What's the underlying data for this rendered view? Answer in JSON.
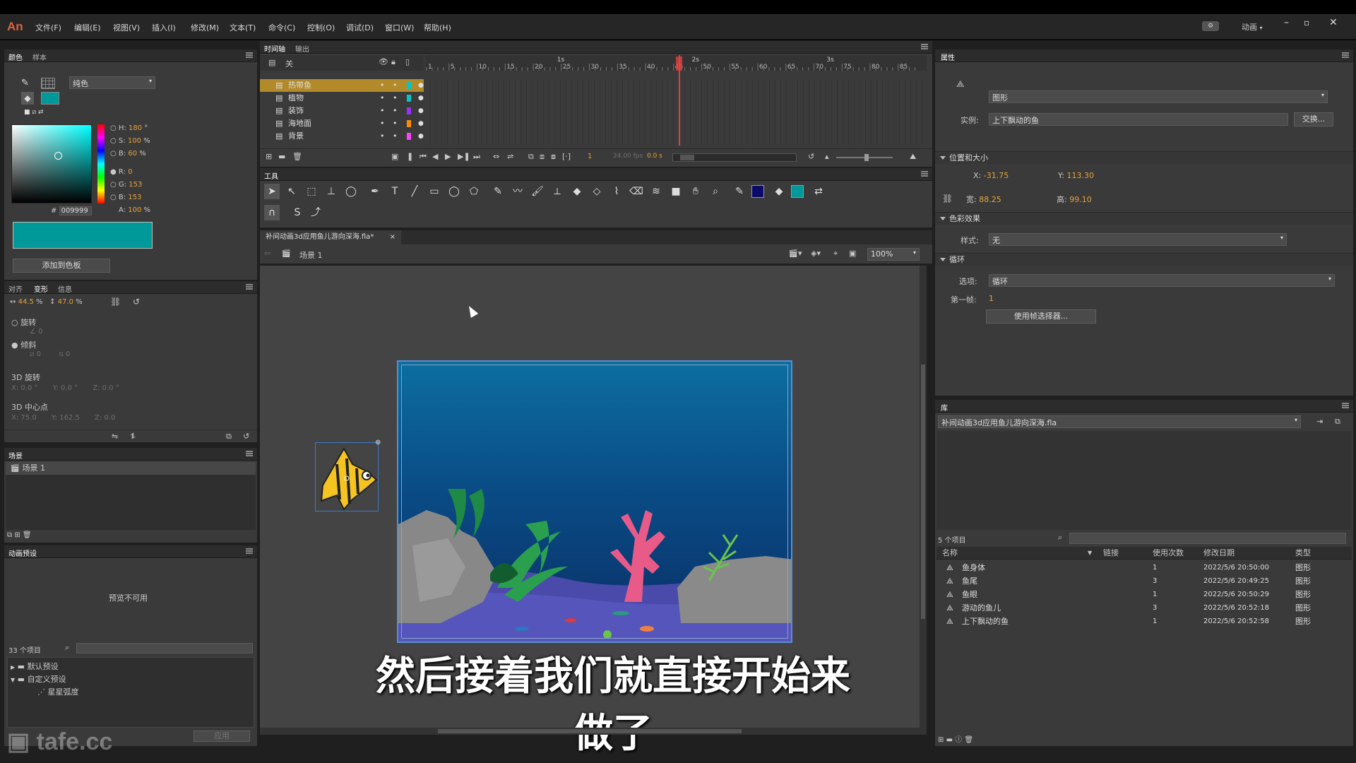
{
  "app": {
    "logo": "An",
    "menu": [
      "文件(F)",
      "编辑(E)",
      "视图(V)",
      "插入(I)",
      "修改(M)",
      "文本(T)",
      "命令(C)",
      "控制(O)",
      "调试(D)",
      "窗口(W)",
      "帮助(H)"
    ],
    "workspace": "动画"
  },
  "color_panel": {
    "tabs": [
      "颜色",
      "样本"
    ],
    "fill_type": "纯色",
    "hsb": {
      "h_label": "H:",
      "h": "180",
      "h_unit": "°",
      "s_label": "S:",
      "s": "100",
      "s_unit": "%",
      "b_label": "B:",
      "b": "60",
      "b_unit": "%"
    },
    "rgb": {
      "r_label": "R:",
      "r": "0",
      "g_label": "G:",
      "g": "153",
      "b_label": "B:",
      "b": "153"
    },
    "alpha_label": "A:",
    "alpha": "100",
    "alpha_unit": "%",
    "hex_label": "#",
    "hex": "009999",
    "add_swatch": "添加到色板",
    "swatch_color": "#009999"
  },
  "transform_panel": {
    "tabs": [
      "对齐",
      "变形",
      "信息"
    ],
    "width_pct": "44.5",
    "height_pct": "47.0",
    "pct": "%",
    "rotate_label": "旋转",
    "rotate_value": "0",
    "skew_label": "倾斜",
    "skew_h": "0",
    "skew_v": "0",
    "rot3d_label": "3D 旋转",
    "rot3d": {
      "x_label": "X:",
      "x": "0.0 °",
      "y_label": "Y:",
      "y": "0.0 °",
      "z_label": "Z:",
      "z": "0.0 °"
    },
    "center3d_label": "3D 中心点",
    "center3d": {
      "x_label": "X:",
      "x": "75.0",
      "y_label": "Y:",
      "y": "162.5",
      "z_label": "Z:",
      "z": "0.0"
    }
  },
  "scene_panel": {
    "title": "场景",
    "scenes": [
      "场景 1"
    ]
  },
  "presets_panel": {
    "title": "动画预设",
    "preview": "预览不可用",
    "count": "33 个项目",
    "tree": [
      {
        "label": "默认预设",
        "expanded": false
      },
      {
        "label": "自定义预设",
        "expanded": true
      },
      {
        "label": "星星弧度",
        "child": true
      }
    ],
    "apply": "应用"
  },
  "timeline": {
    "tabs": [
      "时间轴",
      "输出"
    ],
    "header_label": "关",
    "seconds": [
      "1s",
      "2s",
      "3s"
    ],
    "frame_ticks": [
      "1",
      "5",
      "10",
      "15",
      "20",
      "25",
      "30",
      "35",
      "40",
      "45",
      "50",
      "55",
      "60",
      "65",
      "70",
      "75",
      "80",
      "85"
    ],
    "layers": [
      {
        "name": "热带鱼",
        "color": "#00c8c8",
        "selected": true
      },
      {
        "name": "植物",
        "color": "#00c8c8",
        "selected": false
      },
      {
        "name": "装饰",
        "color": "#9b30ff",
        "selected": false
      },
      {
        "name": "海地面",
        "color": "#ff8c00",
        "selected": false
      },
      {
        "name": "背景",
        "color": "#ff40ff",
        "selected": false
      }
    ],
    "current_frame": "1",
    "fps": "24.00 fps",
    "time": "0.0 s"
  },
  "tools": {
    "title": "工具"
  },
  "document": {
    "tab": "补间动画3d应用鱼儿游向深海.fla*",
    "scene": "场景 1",
    "zoom": "100%"
  },
  "subtitle": "然后接着我们就直接开始来做了",
  "watermark": "tafe.cc",
  "properties": {
    "title": "属性",
    "symbol_type": "图形",
    "instance_label": "实例:",
    "instance_name": "上下飘动的鱼",
    "swap_btn": "交换...",
    "pos_section": "位置和大小",
    "x_label": "X:",
    "x": "-31.75",
    "y_label": "Y:",
    "y": "113.30",
    "w_label": "宽:",
    "w": "88.25",
    "h_label": "高:",
    "h": "99.10",
    "color_section": "色彩效果",
    "style_label": "样式:",
    "style": "无",
    "loop_section": "循环",
    "option_label": "选项:",
    "option": "循环",
    "first_frame_label": "第一帧:",
    "first_frame": "1",
    "frame_picker": "使用帧选择器..."
  },
  "library": {
    "title": "库",
    "file": "补间动画3d应用鱼儿游向深海.fla",
    "count": "5 个项目",
    "columns": [
      "名称",
      "链接",
      "使用次数",
      "修改日期",
      "类型"
    ],
    "items": [
      {
        "name": "鱼身体",
        "uses": "1",
        "date": "2022/5/6 20:50:00",
        "type": "图形"
      },
      {
        "name": "鱼尾",
        "uses": "3",
        "date": "2022/5/6 20:49:25",
        "type": "图形"
      },
      {
        "name": "鱼眼",
        "uses": "1",
        "date": "2022/5/6 20:50:29",
        "type": "图形"
      },
      {
        "name": "游动的鱼儿",
        "uses": "3",
        "date": "2022/5/6 20:52:18",
        "type": "图形"
      },
      {
        "name": "上下飘动的鱼",
        "uses": "1",
        "date": "2022/5/6 20:52:58",
        "type": "图形"
      }
    ]
  }
}
